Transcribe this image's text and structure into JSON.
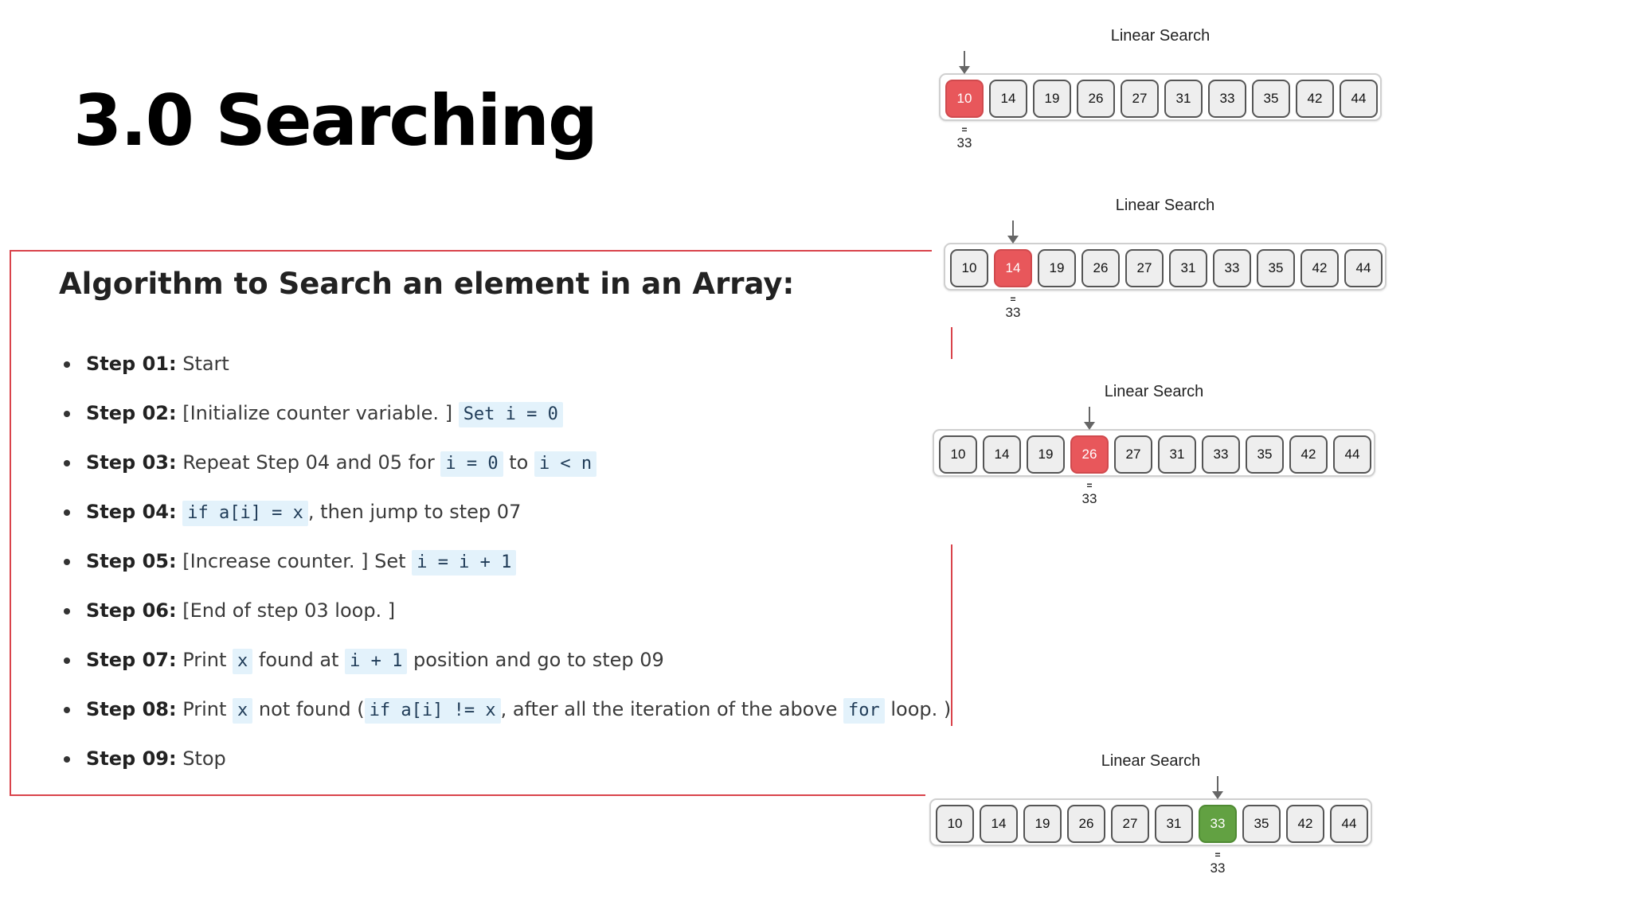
{
  "slide": {
    "title": "3.0 Searching"
  },
  "algorithm": {
    "title": "Algorithm to Search an element in an Array:",
    "steps": [
      {
        "label": "Step 01:",
        "parts": [
          {
            "t": "text",
            "v": " Start"
          }
        ]
      },
      {
        "label": "Step 02:",
        "parts": [
          {
            "t": "text",
            "v": " [Initialize counter variable. ] "
          },
          {
            "t": "code",
            "v": "Set i = 0"
          }
        ]
      },
      {
        "label": "Step 03:",
        "parts": [
          {
            "t": "text",
            "v": " Repeat Step 04 and 05 for "
          },
          {
            "t": "code",
            "v": "i = 0"
          },
          {
            "t": "text",
            "v": " to "
          },
          {
            "t": "code",
            "v": "i < n"
          }
        ]
      },
      {
        "label": "Step 04:",
        "parts": [
          {
            "t": "text",
            "v": " "
          },
          {
            "t": "code",
            "v": "if a[i] = x"
          },
          {
            "t": "text",
            "v": ", then jump to step 07"
          }
        ]
      },
      {
        "label": "Step 05:",
        "parts": [
          {
            "t": "text",
            "v": " [Increase counter. ] Set "
          },
          {
            "t": "code",
            "v": "i = i + 1"
          }
        ]
      },
      {
        "label": "Step 06:",
        "parts": [
          {
            "t": "text",
            "v": " [End of step 03 loop. ]"
          }
        ]
      },
      {
        "label": "Step 07:",
        "parts": [
          {
            "t": "text",
            "v": " Print "
          },
          {
            "t": "code",
            "v": "x"
          },
          {
            "t": "text",
            "v": " found at "
          },
          {
            "t": "code",
            "v": "i + 1"
          },
          {
            "t": "text",
            "v": " position and go to step 09"
          }
        ]
      },
      {
        "label": "Step 08:",
        "parts": [
          {
            "t": "text",
            "v": " Print "
          },
          {
            "t": "code",
            "v": "x"
          },
          {
            "t": "text",
            "v": " not found ("
          },
          {
            "t": "code",
            "v": "if a[i] != x"
          },
          {
            "t": "text",
            "v": ", after all the iteration of the above "
          },
          {
            "t": "code",
            "v": "for"
          },
          {
            "t": "text",
            "v": " loop. )"
          }
        ]
      },
      {
        "label": "Step 09:",
        "parts": [
          {
            "t": "text",
            "v": " Stop"
          }
        ]
      }
    ]
  },
  "diagrams": [
    {
      "title": "Linear Search",
      "values": [
        "10",
        "14",
        "19",
        "26",
        "27",
        "31",
        "33",
        "35",
        "42",
        "44"
      ],
      "current_index": 0,
      "state": "no-match",
      "comparison_symbol": "=",
      "search_key": "33"
    },
    {
      "title": "Linear Search",
      "values": [
        "10",
        "14",
        "19",
        "26",
        "27",
        "31",
        "33",
        "35",
        "42",
        "44"
      ],
      "current_index": 1,
      "state": "no-match",
      "comparison_symbol": "=",
      "search_key": "33"
    },
    {
      "title": "Linear Search",
      "values": [
        "10",
        "14",
        "19",
        "26",
        "27",
        "31",
        "33",
        "35",
        "42",
        "44"
      ],
      "current_index": 3,
      "state": "no-match",
      "comparison_symbol": "=",
      "search_key": "33"
    },
    {
      "title": "Linear Search",
      "values": [
        "10",
        "14",
        "19",
        "26",
        "27",
        "31",
        "33",
        "35",
        "42",
        "44"
      ],
      "current_index": 6,
      "state": "match",
      "comparison_symbol": "=",
      "search_key": "33"
    }
  ],
  "colors": {
    "outline": "#d9434b",
    "no_match": "#e8575b",
    "match": "#62a142",
    "code_bg": "#e3f2fb"
  }
}
